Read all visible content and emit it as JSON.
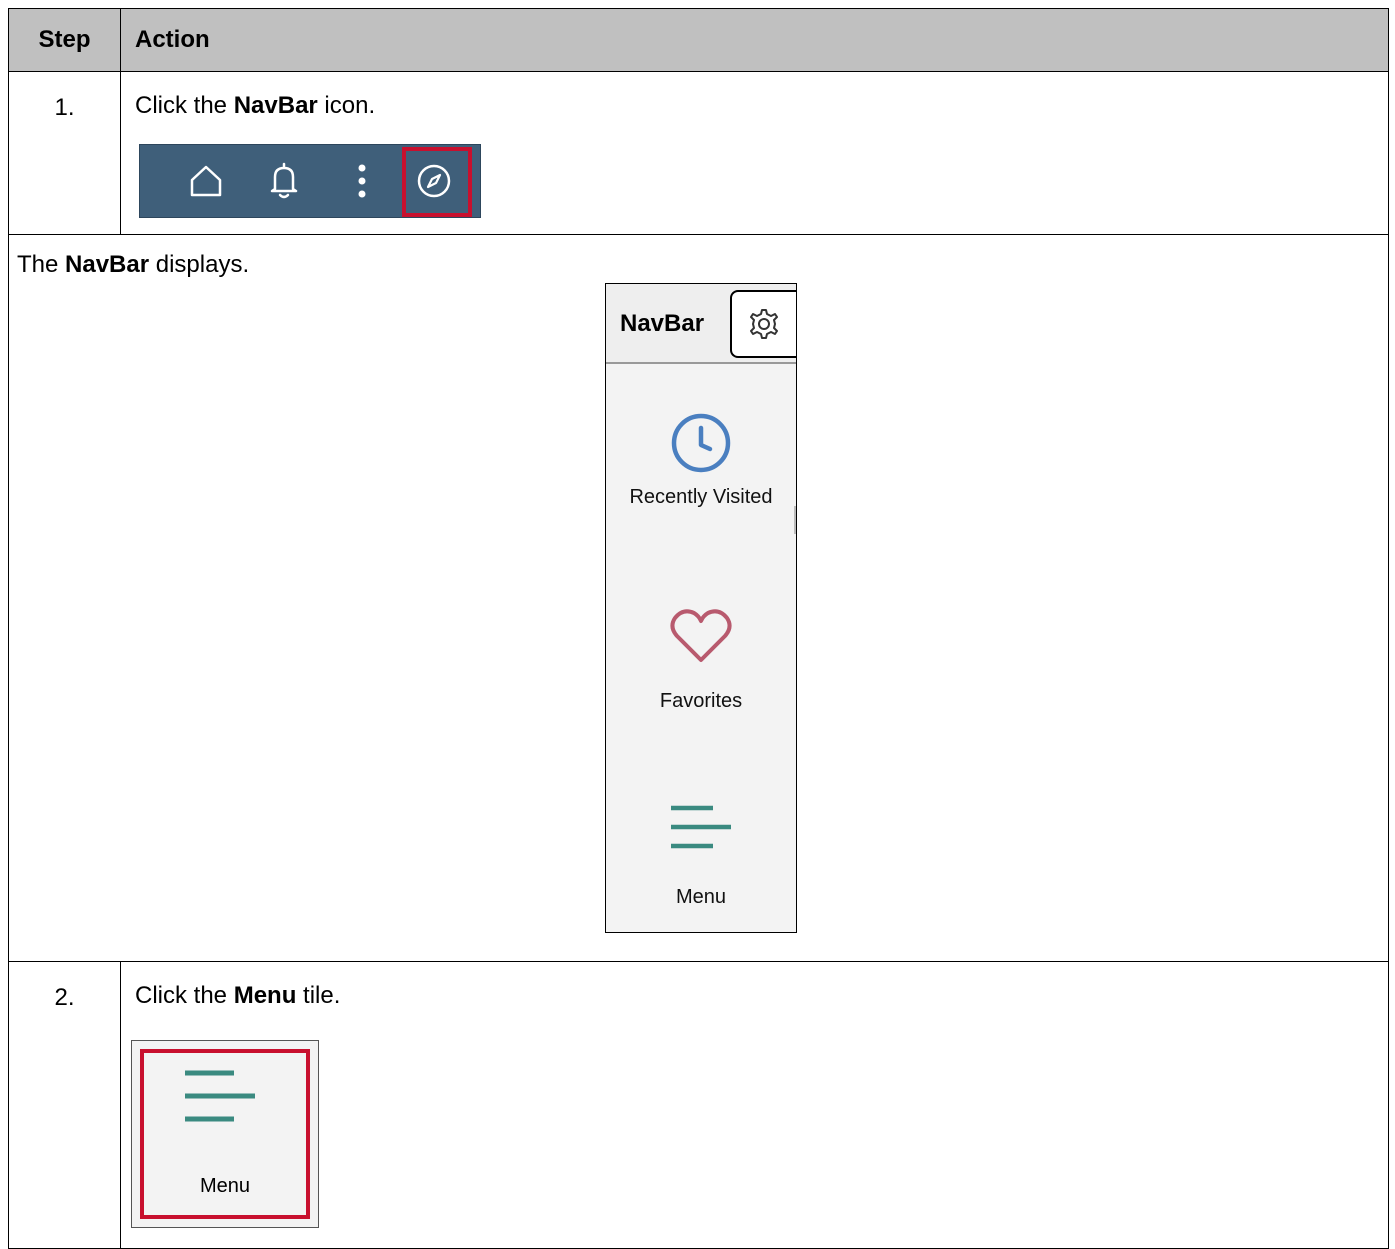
{
  "header": {
    "step_label": "Step",
    "action_label": "Action"
  },
  "step1": {
    "number": "1.",
    "pre": "Click the ",
    "bold": "NavBar",
    "post": " icon.",
    "toolbar_icons": [
      "home-icon",
      "bell-icon",
      "more-vertical-icon",
      "compass-icon"
    ],
    "highlight_color": "#c8102e"
  },
  "info": {
    "pre": "The ",
    "bold": "NavBar",
    "post": " displays.",
    "navbar": {
      "title": "NavBar",
      "items": [
        {
          "label": "Recently Visited",
          "icon": "clock-icon",
          "color": "#4a7fc0"
        },
        {
          "label": "Favorites",
          "icon": "heart-icon",
          "color": "#b85a6e"
        },
        {
          "label": "Menu",
          "icon": "menu-lines-icon",
          "color": "#3a8a80"
        }
      ]
    }
  },
  "step2": {
    "number": "2.",
    "pre": "Click the ",
    "bold": "Menu",
    "post": " tile.",
    "tile_label": "Menu"
  }
}
